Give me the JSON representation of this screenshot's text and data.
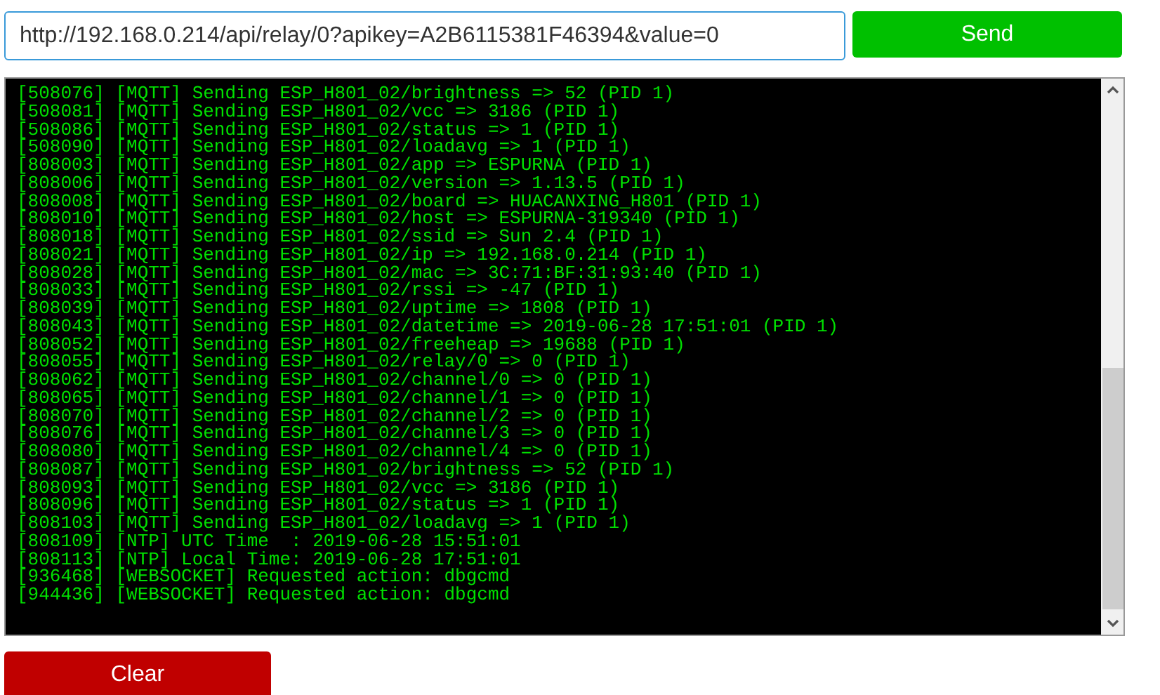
{
  "command": {
    "value": "http://192.168.0.214/api/relay/0?apikey=A2B6115381F46394&value=0"
  },
  "send_button": "Send",
  "console": {
    "lines": [
      "[508076] [MQTT] Sending ESP_H801_02/brightness => 52 (PID 1)",
      "[508081] [MQTT] Sending ESP_H801_02/vcc => 3186 (PID 1)",
      "[508086] [MQTT] Sending ESP_H801_02/status => 1 (PID 1)",
      "[508090] [MQTT] Sending ESP_H801_02/loadavg => 1 (PID 1)",
      "[808003] [MQTT] Sending ESP_H801_02/app => ESPURNA (PID 1)",
      "[808006] [MQTT] Sending ESP_H801_02/version => 1.13.5 (PID 1)",
      "[808008] [MQTT] Sending ESP_H801_02/board => HUACANXING_H801 (PID 1)",
      "[808010] [MQTT] Sending ESP_H801_02/host => ESPURNA-319340 (PID 1)",
      "[808018] [MQTT] Sending ESP_H801_02/ssid => Sun 2.4 (PID 1)",
      "[808021] [MQTT] Sending ESP_H801_02/ip => 192.168.0.214 (PID 1)",
      "[808028] [MQTT] Sending ESP_H801_02/mac => 3C:71:BF:31:93:40 (PID 1)",
      "[808033] [MQTT] Sending ESP_H801_02/rssi => -47 (PID 1)",
      "[808039] [MQTT] Sending ESP_H801_02/uptime => 1808 (PID 1)",
      "[808043] [MQTT] Sending ESP_H801_02/datetime => 2019-06-28 17:51:01 (PID 1)",
      "[808052] [MQTT] Sending ESP_H801_02/freeheap => 19688 (PID 1)",
      "[808055] [MQTT] Sending ESP_H801_02/relay/0 => 0 (PID 1)",
      "[808062] [MQTT] Sending ESP_H801_02/channel/0 => 0 (PID 1)",
      "[808065] [MQTT] Sending ESP_H801_02/channel/1 => 0 (PID 1)",
      "[808070] [MQTT] Sending ESP_H801_02/channel/2 => 0 (PID 1)",
      "[808076] [MQTT] Sending ESP_H801_02/channel/3 => 0 (PID 1)",
      "[808080] [MQTT] Sending ESP_H801_02/channel/4 => 0 (PID 1)",
      "[808087] [MQTT] Sending ESP_H801_02/brightness => 52 (PID 1)",
      "[808093] [MQTT] Sending ESP_H801_02/vcc => 3186 (PID 1)",
      "[808096] [MQTT] Sending ESP_H801_02/status => 1 (PID 1)",
      "[808103] [MQTT] Sending ESP_H801_02/loadavg => 1 (PID 1)",
      "[808109] [NTP] UTC Time  : 2019-06-28 15:51:01",
      "[808113] [NTP] Local Time: 2019-06-28 17:51:01",
      "[936468] [WEBSOCKET] Requested action: dbgcmd",
      "[944436] [WEBSOCKET] Requested action: dbgcmd"
    ]
  },
  "clear_button": "Clear"
}
